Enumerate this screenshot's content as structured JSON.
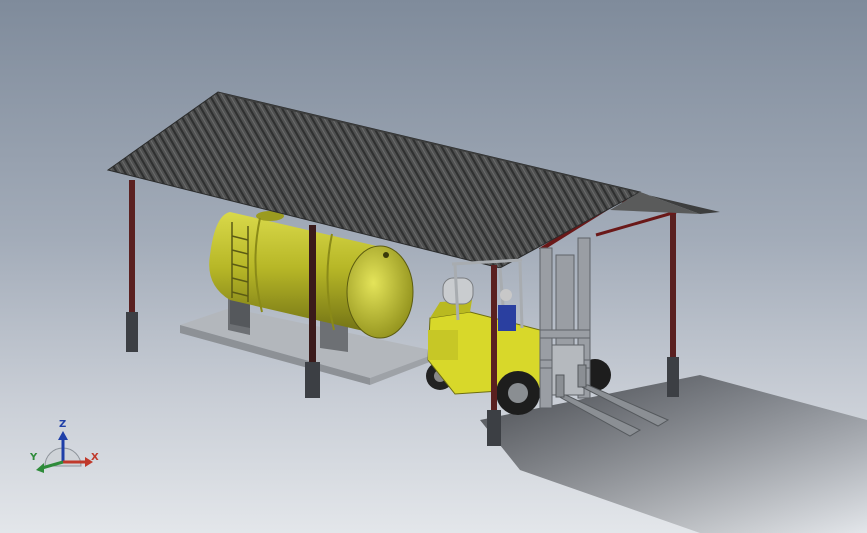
{
  "viewport": {
    "background_top": "#7f8b9b",
    "background_bottom": "#e3e6ea"
  },
  "model": {
    "objects": [
      "corrugated-roof-shelter",
      "horizontal-storage-tank",
      "concrete-pad",
      "forklift"
    ],
    "colors": {
      "roof": "#4e4f4f",
      "columns": "#5a2020",
      "tank": "#b8b827",
      "forklift_body": "#d8d82a",
      "mast": "#9a9ea4",
      "pad": "#a9adb1",
      "shadow": "#2a2c30"
    }
  },
  "triad": {
    "z_label": "Z",
    "x_label": "X",
    "y_label": "Y",
    "z_color": "#1f3fa8",
    "x_color": "#c0392b",
    "y_color": "#2e8b3a"
  }
}
